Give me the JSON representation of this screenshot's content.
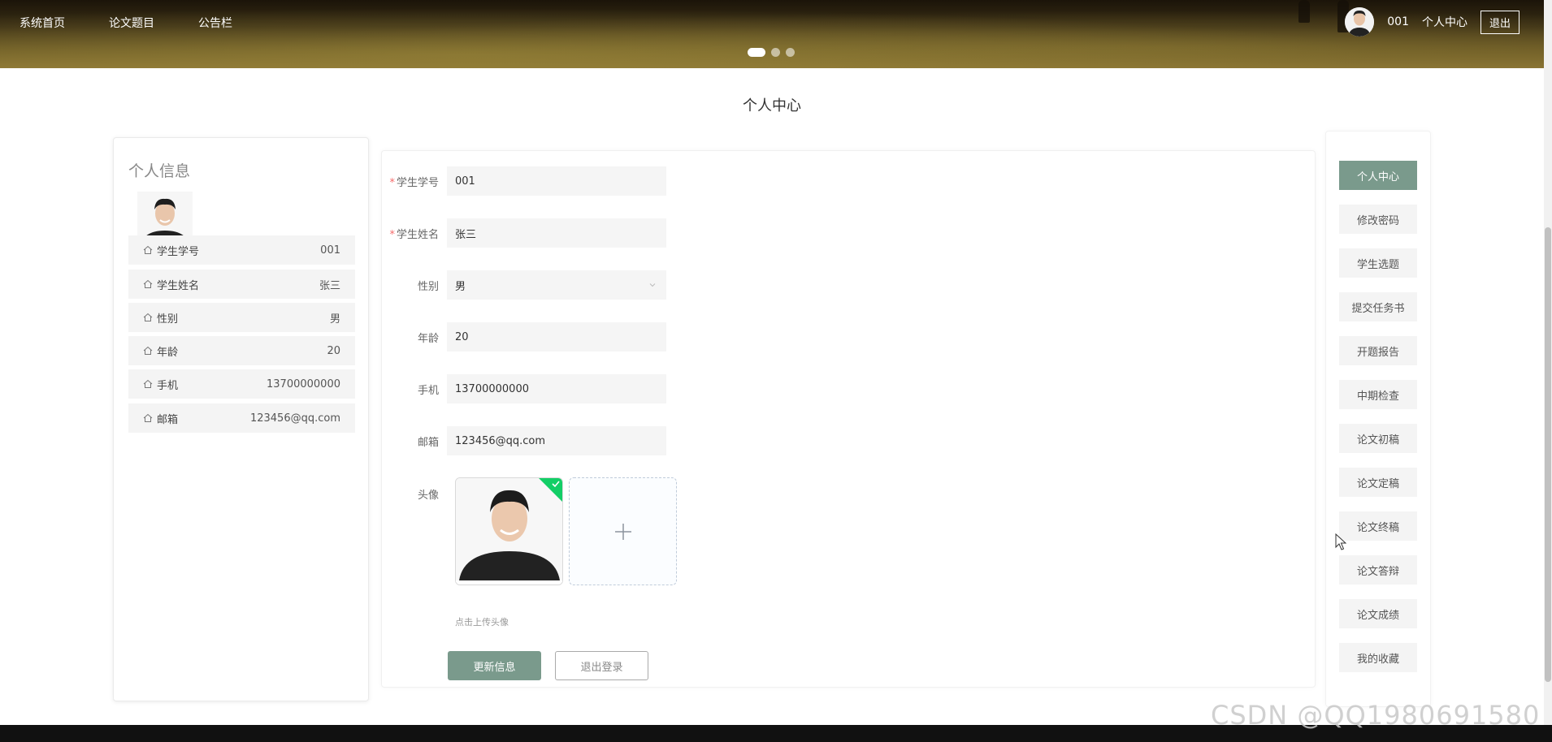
{
  "nav": {
    "items": [
      {
        "label": "系统首页"
      },
      {
        "label": "论文题目"
      },
      {
        "label": "公告栏"
      }
    ]
  },
  "user": {
    "name": "001",
    "center_label": "个人中心",
    "logout_label": "退出"
  },
  "carousel": {
    "count": 3,
    "active": 0
  },
  "page": {
    "title": "个人中心"
  },
  "profile_card": {
    "heading": "个人信息",
    "rows": [
      {
        "label": "学生学号",
        "value": "001"
      },
      {
        "label": "学生姓名",
        "value": "张三"
      },
      {
        "label": "性别",
        "value": "男"
      },
      {
        "label": "年龄",
        "value": "20"
      },
      {
        "label": "手机",
        "value": "13700000000"
      },
      {
        "label": "邮箱",
        "value": "123456@qq.com"
      }
    ]
  },
  "form": {
    "fields": [
      {
        "label": "学生学号",
        "value": "001",
        "required": true
      },
      {
        "label": "学生姓名",
        "value": "张三",
        "required": true
      },
      {
        "label": "性别",
        "value": "男",
        "required": false,
        "type": "select"
      },
      {
        "label": "年龄",
        "value": "20",
        "required": false
      },
      {
        "label": "手机",
        "value": "13700000000",
        "required": false
      },
      {
        "label": "邮箱",
        "value": "123456@qq.com",
        "required": false
      }
    ],
    "avatar_label": "头像",
    "upload_hint": "点击上传头像",
    "submit_label": "更新信息",
    "logout_label": "退出登录",
    "required_mark": "*"
  },
  "side_menu": {
    "items": [
      {
        "label": "个人中心",
        "active": true
      },
      {
        "label": "修改密码"
      },
      {
        "label": "学生选题"
      },
      {
        "label": "提交任务书"
      },
      {
        "label": "开题报告"
      },
      {
        "label": "中期检查"
      },
      {
        "label": "论文初稿"
      },
      {
        "label": "论文定稿"
      },
      {
        "label": "论文终稿"
      },
      {
        "label": "论文答辩"
      },
      {
        "label": "论文成绩"
      },
      {
        "label": "我的收藏"
      }
    ]
  },
  "watermark": "CSDN @QQ1980691580",
  "colors": {
    "accent": "#7a9a8c",
    "success": "#13ce66"
  }
}
